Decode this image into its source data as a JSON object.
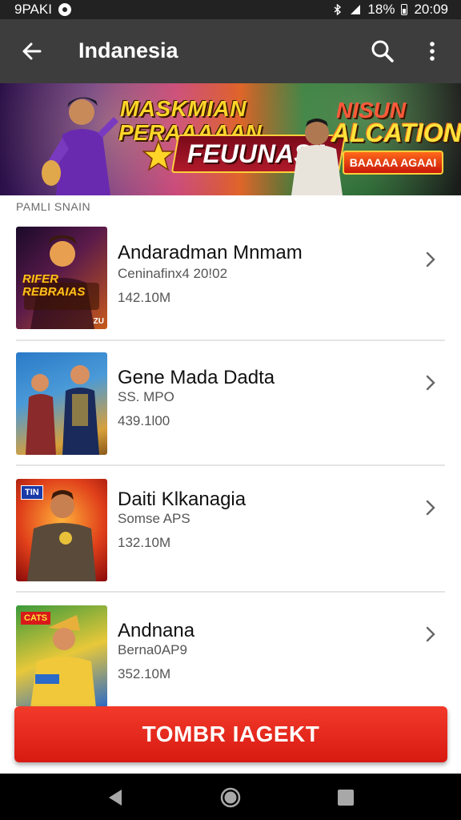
{
  "status_bar": {
    "carrier": "9PAKI",
    "battery_percent": "18%",
    "time": "20:09"
  },
  "app_bar": {
    "title": "Indanesia",
    "back_icon": "arrow-left-icon",
    "search_icon": "search-icon",
    "more_icon": "more-vertical-icon"
  },
  "banner": {
    "line1": "MASKMIAN",
    "line2": "PERAAAAAN",
    "ribbon": "FEUUNASA",
    "right_top": "NISUN",
    "right_mid": "ALCATION",
    "button": "BAAAAA AGAAI"
  },
  "section": {
    "label": "PAMLI SNAIN"
  },
  "apps": [
    {
      "name": "Andaradman  Mnmam",
      "subtitle": "Ceninafinx4 20!02",
      "size": "142.10M",
      "thumb_text": "RIFER REBRAIAS",
      "thumb_corner": "ZU"
    },
    {
      "name": "Gene Mada Dadta",
      "subtitle": "SS. MPO",
      "size": "439.1l00"
    },
    {
      "name": "Daiti Klkanagia",
      "subtitle": "Somse APS",
      "size": "132.10M",
      "thumb_badge": "TIN"
    },
    {
      "name": "Andnana",
      "subtitle": "Berna0AP9",
      "size": "352.10M",
      "thumb_badge": "CATS"
    }
  ],
  "install_button": {
    "label": "TOMBR IAGEKT"
  },
  "colors": {
    "app_bar": "#3d3d3d",
    "accent_red": "#e5261a",
    "status_bar": "#222222"
  }
}
